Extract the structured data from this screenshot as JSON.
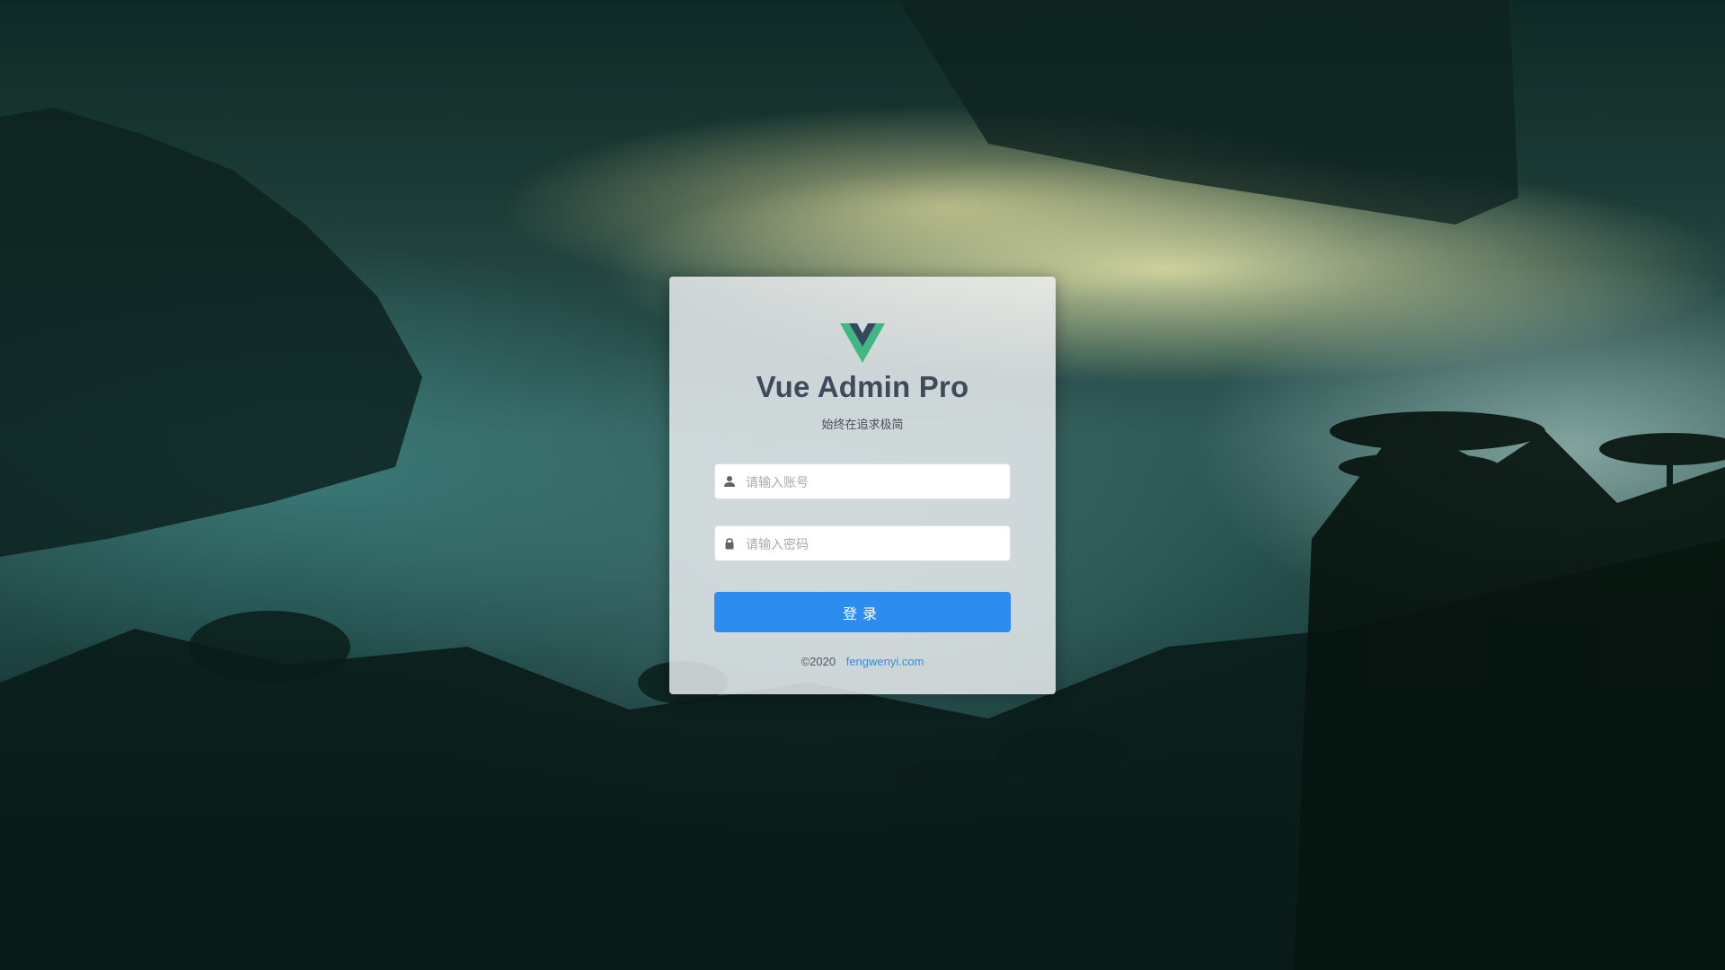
{
  "app": {
    "title": "Vue Admin Pro",
    "subtitle": "始终在追求极简",
    "logo_icon": "vue-logo-icon"
  },
  "form": {
    "username": {
      "placeholder": "请输入账号",
      "value": "",
      "icon": "user-icon"
    },
    "password": {
      "placeholder": "请输入密码",
      "value": "",
      "icon": "lock-icon"
    },
    "login_label": "登录"
  },
  "footer": {
    "copyright": "©2020",
    "link_text": "fengwenyi.com"
  },
  "colors": {
    "primary": "#2d8cf0",
    "title": "#3f4a5c",
    "vue_green": "#41b883",
    "vue_dark": "#35495e"
  }
}
